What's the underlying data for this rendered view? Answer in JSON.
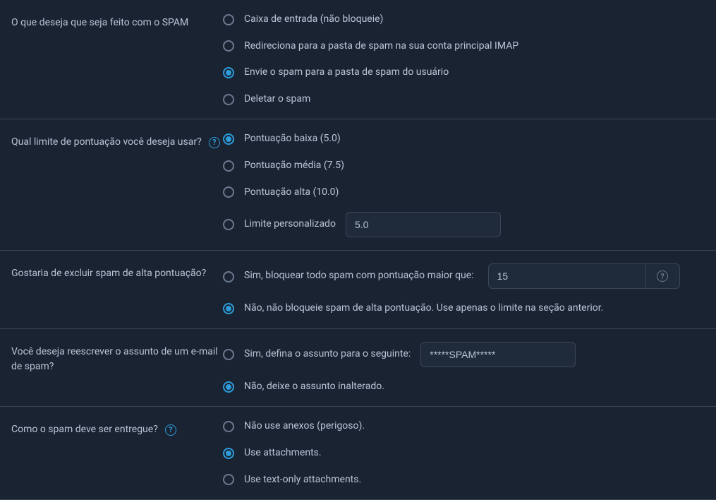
{
  "sections": {
    "spam_action": {
      "label": "O que deseja que seja feito com o SPAM",
      "options": [
        "Caixa de entrada (não bloqueie)",
        "Redireciona para a pasta de spam na sua conta principal IMAP",
        "Envie o spam para a pasta de spam do usuário",
        "Deletar o spam"
      ],
      "selected": 2
    },
    "score_limit": {
      "label": "Qual limite de pontuação você deseja usar?",
      "options": [
        "Pontuação baixa (5.0)",
        "Pontuação média (7.5)",
        "Pontuação alta (10.0)",
        "Limite personalizado"
      ],
      "custom_value": "5.0",
      "selected": 0
    },
    "high_score": {
      "label": "Gostaria de excluir spam de alta pontuação?",
      "option_yes": "Sim, bloquear todo spam com pontuação maior que:",
      "option_no": "Não, não bloqueie spam de alta pontuação. Use apenas o limite na seção anterior.",
      "value": "15",
      "selected": 1
    },
    "rewrite_subject": {
      "label": "Você deseja reescrever o assunto de um e-mail de spam?",
      "option_yes": "Sim, defina o assunto para o seguinte:",
      "option_no": "Não, deixe o assunto inalterado.",
      "value": "*****SPAM*****",
      "selected": 1
    },
    "delivery": {
      "label": "Como o spam deve ser entregue?",
      "options": [
        "Não use anexos (perigoso).",
        "Use attachments.",
        "Use text-only attachments."
      ],
      "selected": 1
    }
  }
}
